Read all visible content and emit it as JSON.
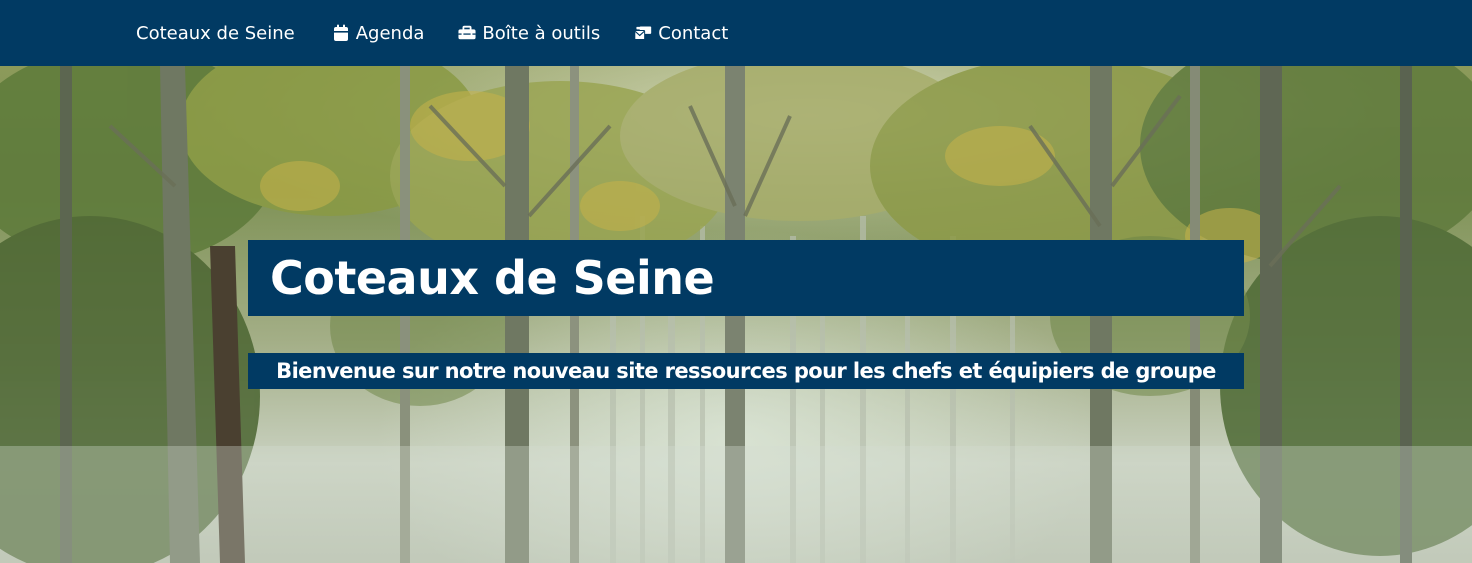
{
  "nav": {
    "brand": "Coteaux de Seine",
    "items": [
      {
        "label": "Agenda",
        "icon": "calendar-icon"
      },
      {
        "label": "Boîte à outils",
        "icon": "toolbox-icon"
      },
      {
        "label": "Contact",
        "icon": "mail-bulk-icon"
      }
    ]
  },
  "hero": {
    "title": "Coteaux de Seine",
    "subtitle": "Bienvenue sur notre nouveau site ressources pour les chefs et équipiers de groupe"
  },
  "colors": {
    "brand": "#013a63",
    "text": "#ffffff"
  }
}
